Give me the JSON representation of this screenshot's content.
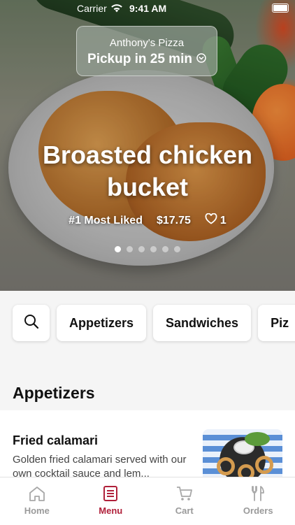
{
  "status_bar": {
    "carrier": "Carrier",
    "time": "9:41 AM"
  },
  "store": {
    "name": "Anthony's Pizza",
    "pickup": "Pickup in 25 min"
  },
  "featured": {
    "title": "Broasted chicken bucket",
    "rank": "#1 Most Liked",
    "price": "$17.75",
    "likes": "1",
    "carousel": {
      "count": 6,
      "active_index": 0
    }
  },
  "categories": [
    "Appetizers",
    "Sandwiches",
    "Piz"
  ],
  "section": {
    "title": "Appetizers"
  },
  "items": [
    {
      "name": "Fried calamari",
      "description": "Golden fried calamari served with our own cocktail sauce and lem..."
    }
  ],
  "tabs": [
    {
      "label": "Home",
      "icon": "home-icon",
      "active": false
    },
    {
      "label": "Menu",
      "icon": "menu-icon",
      "active": true
    },
    {
      "label": "Cart",
      "icon": "cart-icon",
      "active": false
    },
    {
      "label": "Orders",
      "icon": "orders-icon",
      "active": false
    }
  ],
  "colors": {
    "accent": "#b0203a",
    "inactive": "#9a9a9a"
  }
}
